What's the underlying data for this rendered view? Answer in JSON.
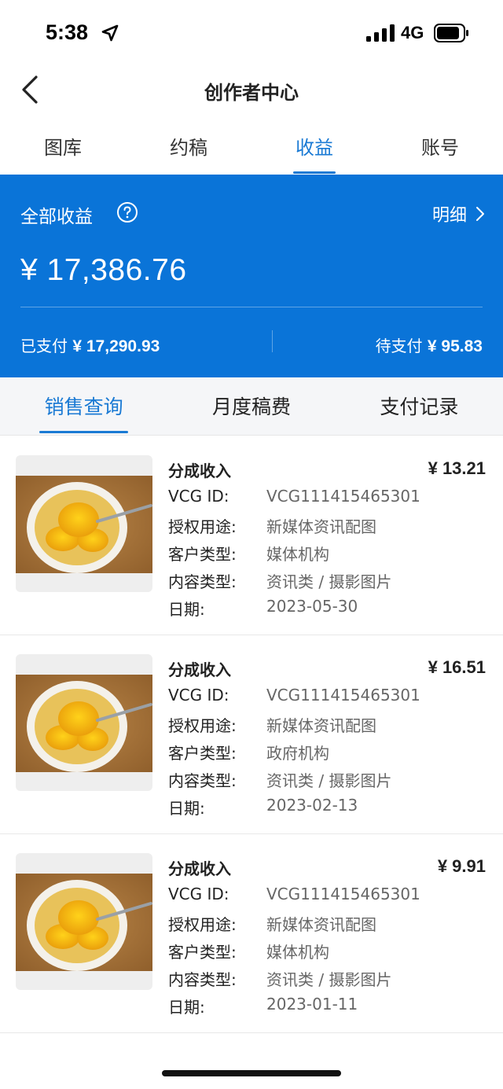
{
  "status_bar": {
    "time": "5:38",
    "network": "4G"
  },
  "nav": {
    "title": "创作者中心"
  },
  "top_tabs": [
    {
      "label": "图库"
    },
    {
      "label": "约稿"
    },
    {
      "label": "收益"
    },
    {
      "label": "账号"
    }
  ],
  "earnings": {
    "label": "全部收益",
    "detail_link": "明细",
    "total": "¥ 17,386.76",
    "paid_label": "已支付",
    "paid_amount": "¥ 17,290.93",
    "pending_label": "待支付",
    "pending_amount": "¥ 95.83"
  },
  "sub_tabs": [
    {
      "label": "销售查询"
    },
    {
      "label": "月度稿费"
    },
    {
      "label": "支付记录"
    }
  ],
  "field_labels": {
    "vcg_id": "VCG ID:",
    "usage": "授权用途:",
    "client_type": "客户类型:",
    "content_type": "内容类型:",
    "date": "日期:"
  },
  "records": [
    {
      "type": "分成收入",
      "amount": "¥ 13.21",
      "vcg_id": "VCG111415465301",
      "usage": "新媒体资讯配图",
      "client_type": "媒体机构",
      "content_type": "资讯类 / 摄影图片",
      "date": "2023-05-30"
    },
    {
      "type": "分成收入",
      "amount": "¥ 16.51",
      "vcg_id": "VCG111415465301",
      "usage": "新媒体资讯配图",
      "client_type": "政府机构",
      "content_type": "资讯类 / 摄影图片",
      "date": "2023-02-13"
    },
    {
      "type": "分成收入",
      "amount": "¥ 9.91",
      "vcg_id": "VCG111415465301",
      "usage": "新媒体资讯配图",
      "client_type": "媒体机构",
      "content_type": "资讯类 / 摄影图片",
      "date": "2023-01-11"
    }
  ],
  "colors": {
    "accent": "#1a7ad4",
    "panel": "#0a74d8",
    "subtab_bg": "#f5f6f8"
  }
}
